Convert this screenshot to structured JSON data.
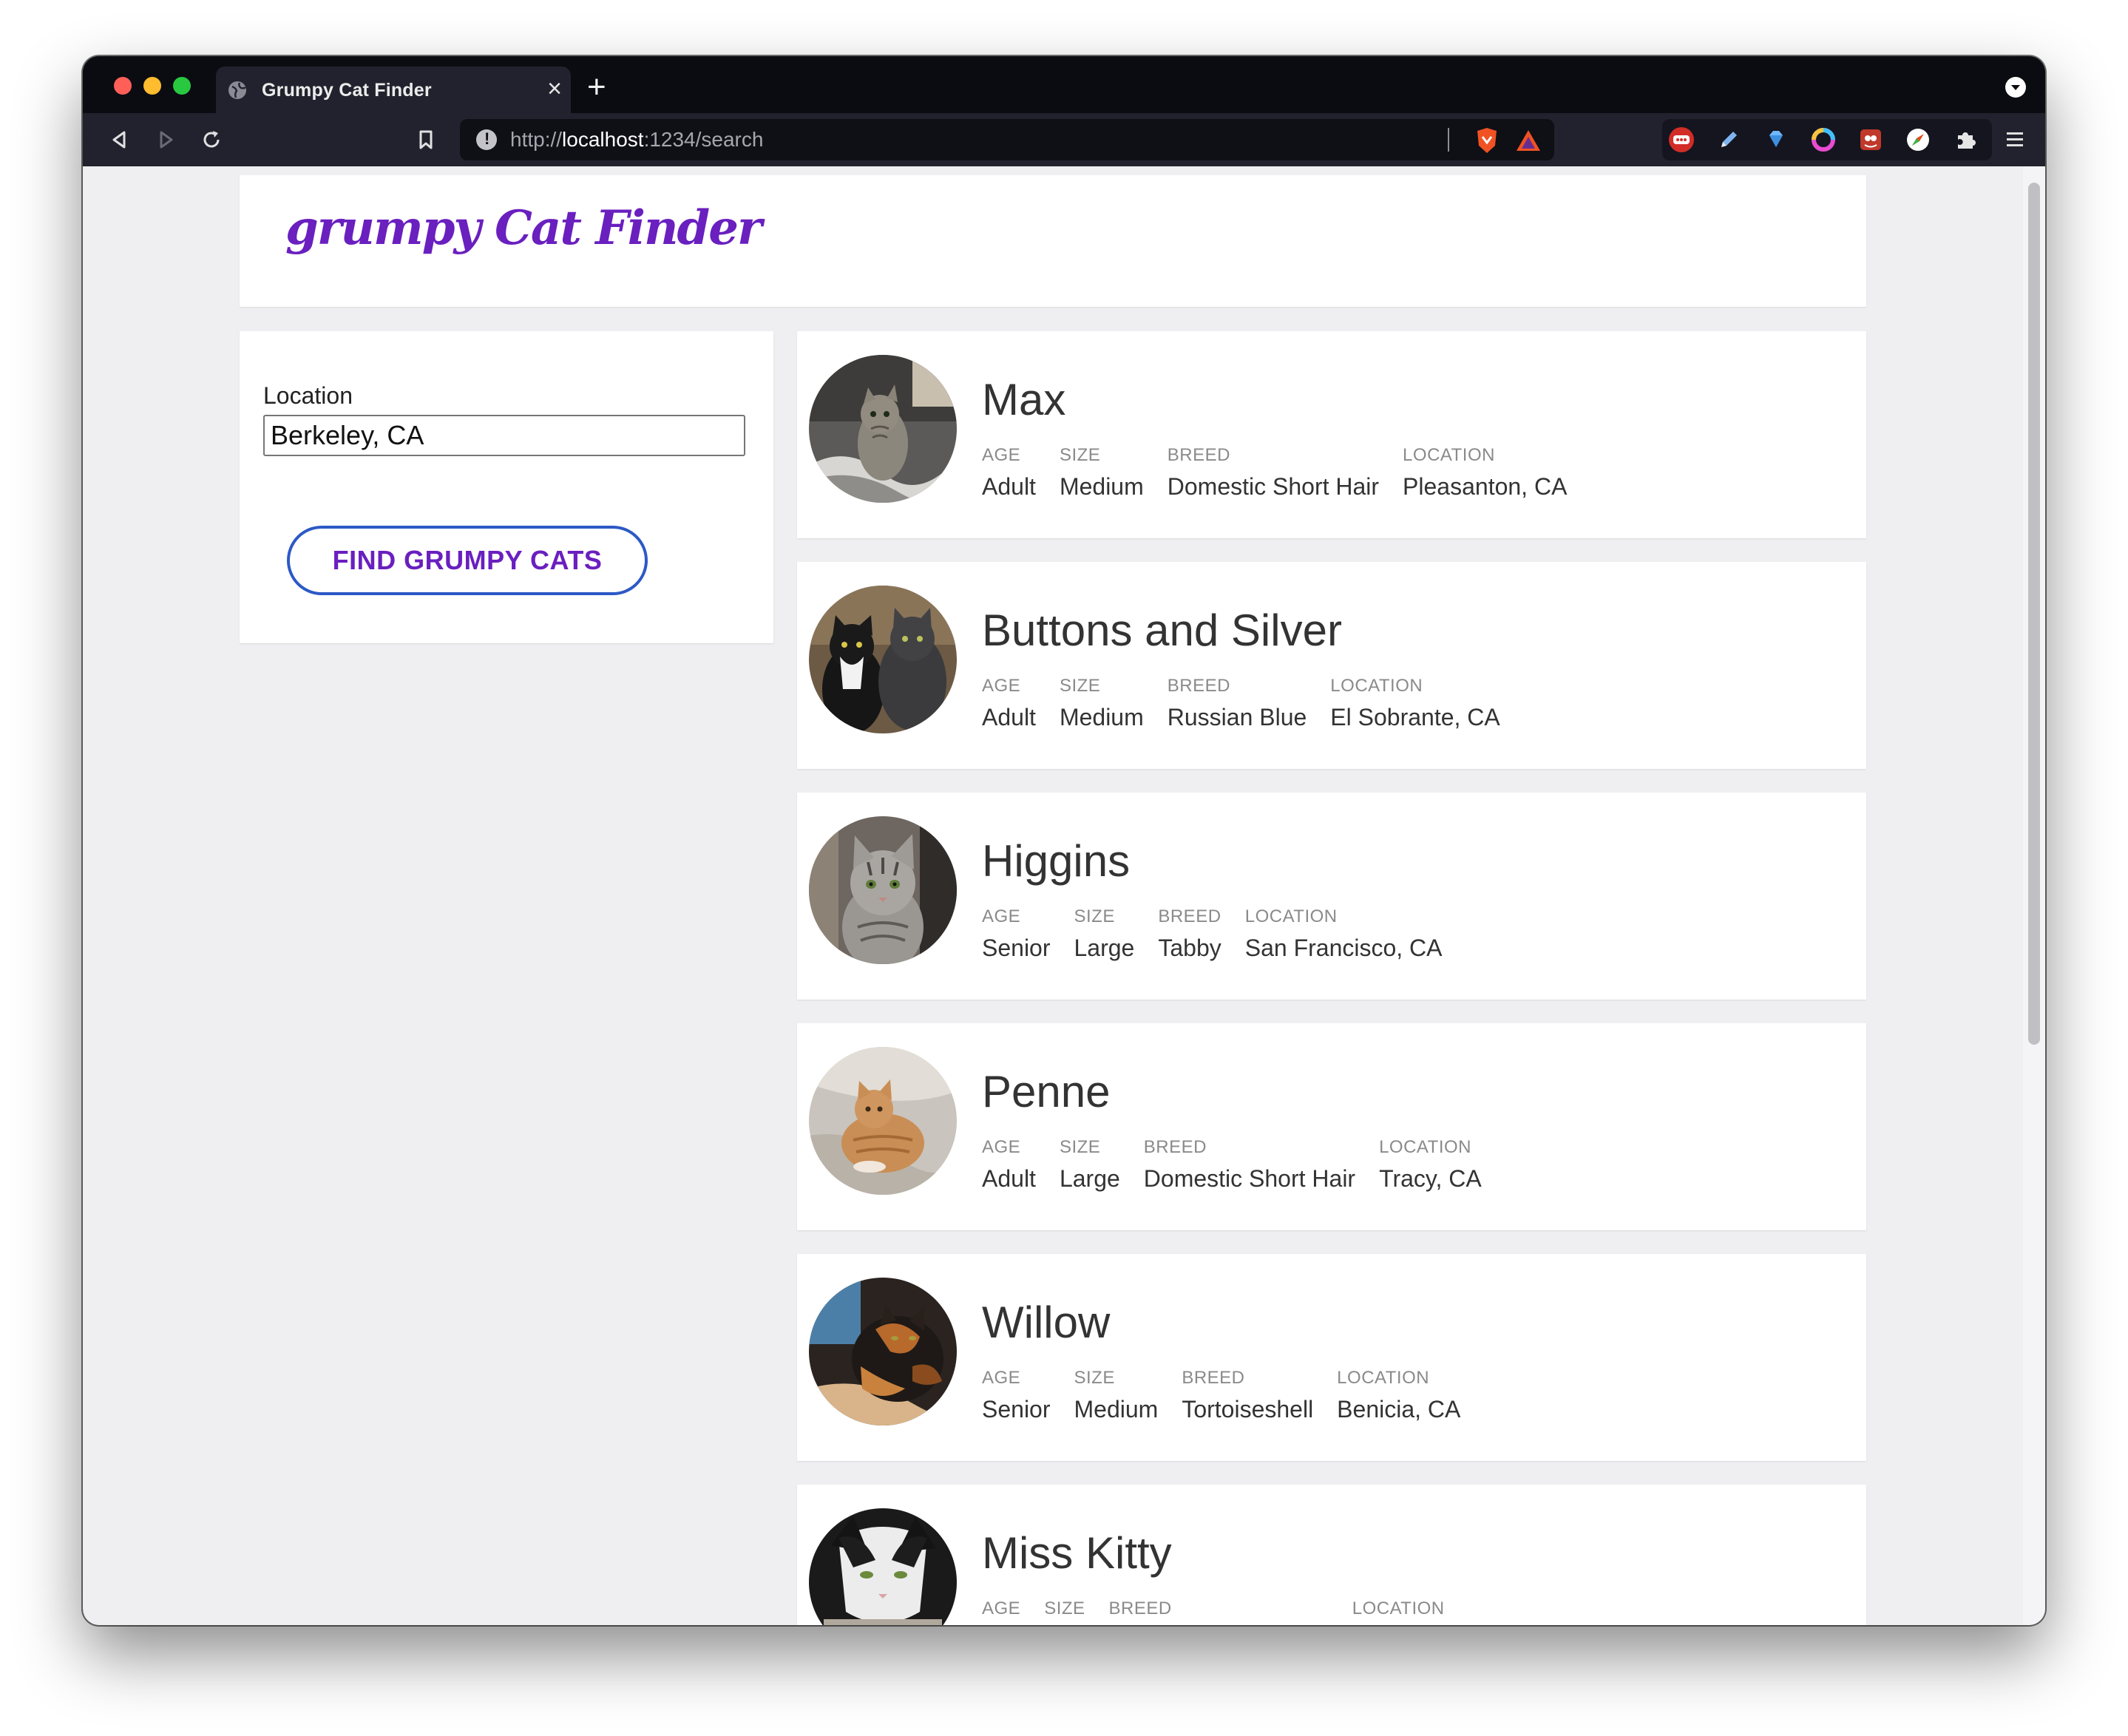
{
  "browser": {
    "tab_title": "Grumpy Cat Finder",
    "url_scheme": "http://",
    "url_host": "localhost",
    "url_path": ":1234/search"
  },
  "app": {
    "logo": "grumpy Cat Finder"
  },
  "search": {
    "location_label": "Location",
    "location_value": "Berkeley, CA",
    "button_label": "FIND GRUMPY CATS"
  },
  "results": [
    {
      "name": "Max",
      "age_label": "AGE",
      "age": "Adult",
      "size_label": "SIZE",
      "size": "Medium",
      "breed_label": "BREED",
      "breed": "Domestic Short Hair",
      "location_label": "LOCATION",
      "location": "Pleasanton, CA",
      "photo": "gray-tabby-kitten-photo"
    },
    {
      "name": "Buttons and Silver",
      "age_label": "AGE",
      "age": "Adult",
      "size_label": "SIZE",
      "size": "Medium",
      "breed_label": "BREED",
      "breed": "Russian Blue",
      "location_label": "LOCATION",
      "location": "El Sobrante, CA",
      "photo": "two-dark-cats-photo"
    },
    {
      "name": "Higgins",
      "age_label": "AGE",
      "age": "Senior",
      "size_label": "SIZE",
      "size": "Large",
      "breed_label": "BREED",
      "breed": "Tabby",
      "location_label": "LOCATION",
      "location": "San Francisco, CA",
      "photo": "silver-tabby-photo"
    },
    {
      "name": "Penne",
      "age_label": "AGE",
      "age": "Adult",
      "size_label": "SIZE",
      "size": "Large",
      "breed_label": "BREED",
      "breed": "Domestic Short Hair",
      "location_label": "LOCATION",
      "location": "Tracy, CA",
      "photo": "orange-tabby-photo"
    },
    {
      "name": "Willow",
      "age_label": "AGE",
      "age": "Senior",
      "size_label": "SIZE",
      "size": "Medium",
      "breed_label": "BREED",
      "breed": "Tortoiseshell",
      "location_label": "LOCATION",
      "location": "Benicia, CA",
      "photo": "tortoiseshell-cat-photo"
    },
    {
      "name": "Miss Kitty",
      "age_label": "AGE",
      "age": "",
      "size_label": "SIZE",
      "size": "",
      "breed_label": "BREED",
      "breed": "",
      "location_label": "LOCATION",
      "location": "",
      "photo": "black-white-cat-photo"
    }
  ],
  "colors": {
    "brand_purple": "#6a1fbf",
    "button_border": "#2d59c6",
    "page_background": "#efeff1"
  }
}
